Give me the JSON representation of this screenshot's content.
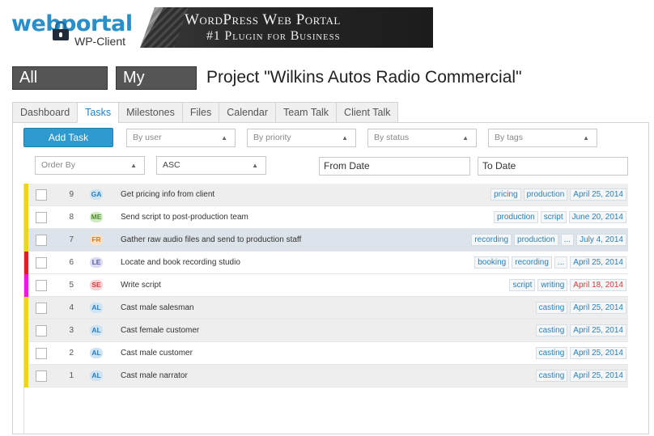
{
  "header": {
    "logo_main": "webportal",
    "logo_sub": "WP-Client",
    "banner_line1": "WordPress Web Portal",
    "banner_line2": "#1 Plugin for Business"
  },
  "title_row": {
    "all_projects": "All Projects",
    "my_tasks": "My Tasks",
    "project_title": "Project \"Wilkins Autos Radio Commercial\""
  },
  "tabs": [
    {
      "label": "Dashboard",
      "active": false
    },
    {
      "label": "Tasks",
      "active": true
    },
    {
      "label": "Milestones",
      "active": false
    },
    {
      "label": "Files",
      "active": false
    },
    {
      "label": "Calendar",
      "active": false
    },
    {
      "label": "Team Talk",
      "active": false
    },
    {
      "label": "Client Talk",
      "active": false
    }
  ],
  "toolbar": {
    "add_task": "Add Task",
    "by_user": "By user",
    "by_priority": "By priority",
    "by_status": "By status",
    "by_tags": "By tags",
    "order_by": "Order By",
    "order_dir": "ASC",
    "from_date": "From Date",
    "to_date": "To Date",
    "arrow": "▲"
  },
  "colors": {
    "accent": "#2e9ad0",
    "prio_yellow": "#f2d21b",
    "prio_red": "#dd1f1f",
    "prio_magenta": "#ee18e0",
    "overdue": "#d23b3b"
  },
  "tasks": [
    {
      "num": "9",
      "initials": "GA",
      "avatar_bg": "#cfe3f3",
      "avatar_fg": "#2a7fb8",
      "title": "Get pricing info from client",
      "tags": [
        "pricing",
        "production"
      ],
      "more": false,
      "date": "April 25, 2014",
      "overdue": false,
      "prio": "#f2d21b",
      "row": "gray"
    },
    {
      "num": "8",
      "initials": "ME",
      "avatar_bg": "#d3ebc4",
      "avatar_fg": "#4c8b2b",
      "title": "Send script to post-production team",
      "tags": [
        "production",
        "script"
      ],
      "more": false,
      "date": "June 20, 2014",
      "overdue": false,
      "prio": "#f2d21b",
      "row": "white"
    },
    {
      "num": "7",
      "initials": "FR",
      "avatar_bg": "#fde0c4",
      "avatar_fg": "#e07b20",
      "title": "Gather raw audio files and send to production staff",
      "tags": [
        "recording",
        "production"
      ],
      "more": true,
      "date": "July 4, 2014",
      "overdue": false,
      "prio": "#f2d21b",
      "row": "hl"
    },
    {
      "num": "6",
      "initials": "LE",
      "avatar_bg": "#dcdcf2",
      "avatar_fg": "#5a5aa8",
      "title": "Locate and book recording studio",
      "tags": [
        "booking",
        "recording"
      ],
      "more": true,
      "date": "April 25, 2014",
      "overdue": false,
      "prio": "#dd1f1f",
      "row": "white"
    },
    {
      "num": "5",
      "initials": "SE",
      "avatar_bg": "#f8d4d4",
      "avatar_fg": "#d04040",
      "title": "Write script",
      "tags": [
        "script",
        "writing"
      ],
      "more": false,
      "date": "April 18, 2014",
      "overdue": true,
      "prio": "#ee18e0",
      "row": "white"
    },
    {
      "num": "4",
      "initials": "AL",
      "avatar_bg": "#cfe3f3",
      "avatar_fg": "#2a7fb8",
      "title": "Cast male salesman",
      "tags": [
        "casting"
      ],
      "more": false,
      "date": "April 25, 2014",
      "overdue": false,
      "prio": "#f2d21b",
      "row": "gray"
    },
    {
      "num": "3",
      "initials": "AL",
      "avatar_bg": "#cfe3f3",
      "avatar_fg": "#2a7fb8",
      "title": "Cast female customer",
      "tags": [
        "casting"
      ],
      "more": false,
      "date": "April 25, 2014",
      "overdue": false,
      "prio": "#f2d21b",
      "row": "gray"
    },
    {
      "num": "2",
      "initials": "AL",
      "avatar_bg": "#cfe3f3",
      "avatar_fg": "#2a7fb8",
      "title": "Cast male customer",
      "tags": [
        "casting"
      ],
      "more": false,
      "date": "April 25, 2014",
      "overdue": false,
      "prio": "#f2d21b",
      "row": "white"
    },
    {
      "num": "1",
      "initials": "AL",
      "avatar_bg": "#cfe3f3",
      "avatar_fg": "#2a7fb8",
      "title": "Cast male narrator",
      "tags": [
        "casting"
      ],
      "more": false,
      "date": "April 25, 2014",
      "overdue": false,
      "prio": "#f2d21b",
      "row": "gray"
    }
  ]
}
